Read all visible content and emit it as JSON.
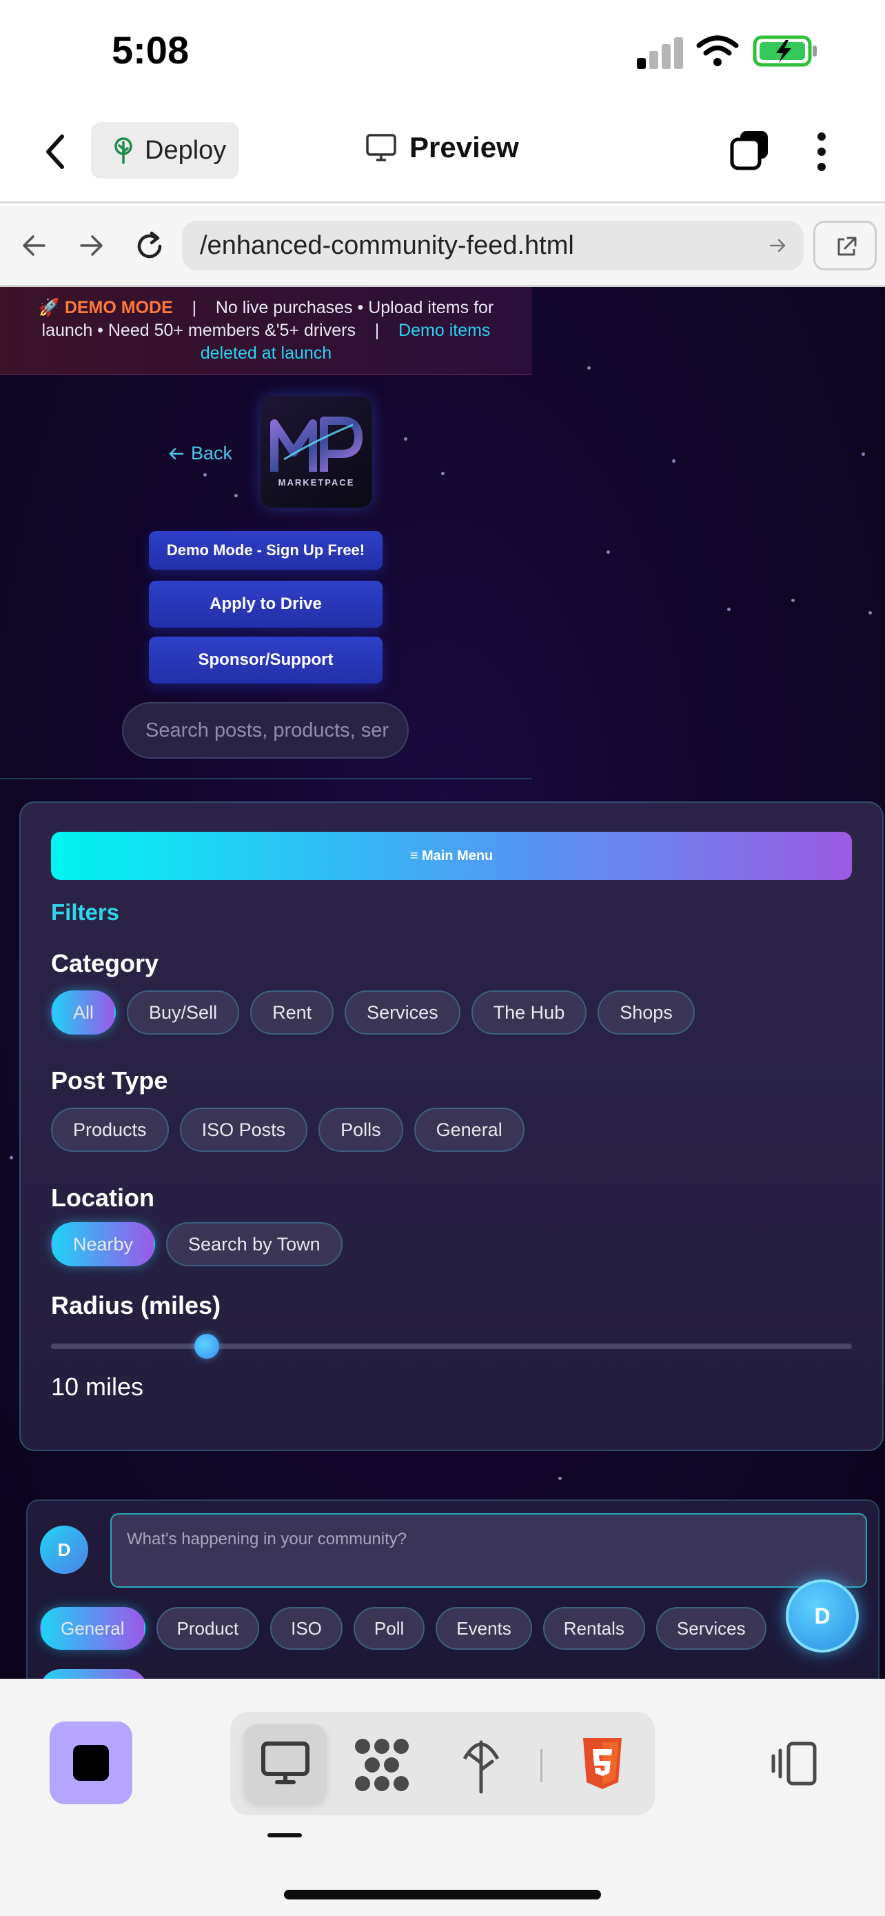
{
  "status_bar": {
    "time": "5:08"
  },
  "app_header": {
    "deploy_label": "Deploy",
    "preview_label": "Preview"
  },
  "browser": {
    "url": "/enhanced-community-feed.html"
  },
  "page": {
    "demo_banner": {
      "badge": "🚀 DEMO MODE",
      "sep1": "|",
      "text1": "No live purchases • Upload items for launch • Need 50+ members &'5+ drivers",
      "sep2": "|",
      "link": "Demo items deleted at launch"
    },
    "back_label": "Back",
    "logo": {
      "monogram": "MP",
      "wordmark": "MARKETPACE"
    },
    "buttons": {
      "demo_signup": "Demo Mode - Sign Up Free!",
      "apply_drive": "Apply to Drive",
      "sponsor": "Sponsor/Support"
    },
    "search_placeholder": "Search posts, products, ser",
    "filters": {
      "main_menu": "≡ Main Menu",
      "title": "Filters",
      "category": {
        "title": "Category",
        "options": [
          "All",
          "Buy/Sell",
          "Rent",
          "Services",
          "The Hub",
          "Shops"
        ],
        "selected": "All"
      },
      "post_type": {
        "title": "Post Type",
        "options": [
          "Products",
          "ISO Posts",
          "Polls",
          "General"
        ]
      },
      "location": {
        "title": "Location",
        "options": [
          "Nearby",
          "Search by Town"
        ],
        "selected": "Nearby"
      },
      "radius": {
        "title": "Radius (miles)",
        "value_label": "10 miles",
        "value": 10
      }
    },
    "composer": {
      "avatar": "D",
      "placeholder": "What's happening in your community?",
      "types": [
        "General",
        "Product",
        "ISO",
        "Poll",
        "Events",
        "Rentals",
        "Services"
      ],
      "selected": "General"
    },
    "fab_label": "D"
  },
  "colors": {
    "accent_cyan": "#29d3f0",
    "accent_purple": "#9a5be3",
    "button_blue": "#2f3fc8",
    "demo_orange": "#ff7a3a"
  }
}
